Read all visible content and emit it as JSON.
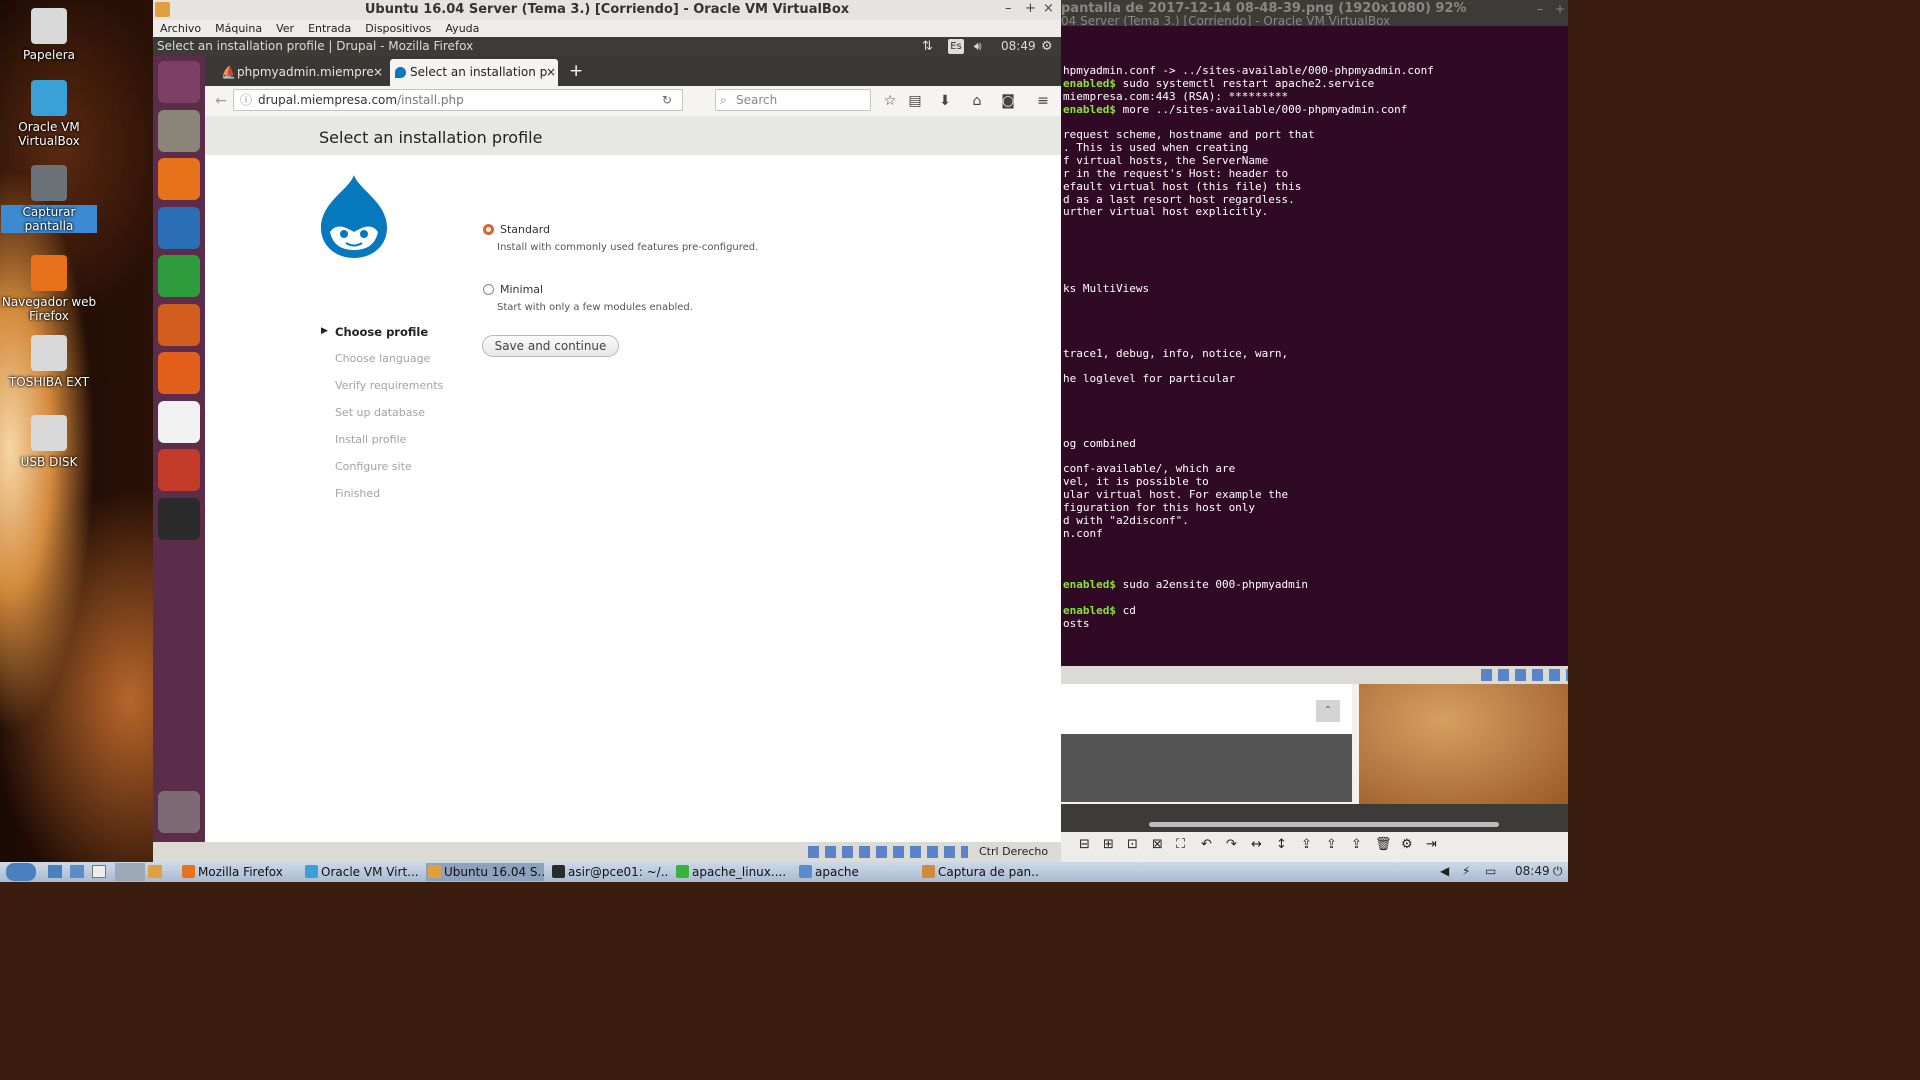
{
  "desktop": {
    "icons": [
      {
        "label": "Papelera",
        "icon": "trash-icon",
        "color": "#d9d9d9"
      },
      {
        "label": "Oracle VM VirtualBox",
        "icon": "virtualbox-icon",
        "color": "#3aa0d8"
      },
      {
        "label": "Capturar pantalla",
        "icon": "camera-icon",
        "color": "#6b7278"
      },
      {
        "label": "Navegador web Firefox",
        "icon": "firefox-icon",
        "color": "#e8711c"
      },
      {
        "label": "TOSHIBA EXT",
        "icon": "usb-drive-icon",
        "color": "#d9d9d9"
      },
      {
        "label": "USB DISK",
        "icon": "usb-drive-icon",
        "color": "#d9d9d9"
      }
    ]
  },
  "vbox": {
    "title": "Ubuntu 16.04 Server (Tema 3.) [Corriendo] - Oracle VM VirtualBox",
    "menu": [
      "Archivo",
      "Máquina",
      "Ver",
      "Entrada",
      "Dispositivos",
      "Ayuda"
    ],
    "status_host_key": "Ctrl Derecho"
  },
  "guest": {
    "window_title": "Select an installation profile | Drupal - Mozilla Firefox",
    "keyboard": "Es",
    "clock": "08:49",
    "launcher": [
      {
        "icon": "ubuntu-dash-icon",
        "color": "#7d3f66"
      },
      {
        "icon": "files-icon",
        "color": "#8c8579"
      },
      {
        "icon": "firefox-icon",
        "color": "#e8711c"
      },
      {
        "icon": "writer-icon",
        "color": "#2a6fb6"
      },
      {
        "icon": "calc-icon",
        "color": "#2e9c3d"
      },
      {
        "icon": "impress-icon",
        "color": "#d35d1e"
      },
      {
        "icon": "software-center-icon",
        "color": "#e45f1c"
      },
      {
        "icon": "amazon-icon",
        "color": "#f1f1f1"
      },
      {
        "icon": "system-settings-icon",
        "color": "#c43b2a"
      },
      {
        "icon": "terminal-icon",
        "color": "#2b2b2b"
      },
      {
        "icon": "trash-icon",
        "color": "#7d6a74"
      }
    ]
  },
  "firefox": {
    "tabs": [
      {
        "label": "phpmyadmin.miempre",
        "active": false
      },
      {
        "label": "Select an installation p",
        "active": true
      }
    ],
    "url_host": "drupal.miempresa.com",
    "url_path": "/install.php",
    "search_placeholder": "Search"
  },
  "drupal": {
    "page_title": "Select an installation profile",
    "steps": [
      "Choose profile",
      "Choose language",
      "Verify requirements",
      "Set up database",
      "Install profile",
      "Configure site",
      "Finished"
    ],
    "active_step": 0,
    "options": [
      {
        "label": "Standard",
        "description": "Install with commonly used features pre-configured.",
        "selected": true
      },
      {
        "label": "Minimal",
        "description": "Start with only a few modules enabled.",
        "selected": false
      }
    ],
    "submit_label": "Save and continue",
    "accent": "#0678be"
  },
  "viewer": {
    "title": "pantalla de 2017-12-14 08-48-39.png (1920x1080) 92%",
    "subtitle": "04 Server (Tema 3.) [Corriendo] - Oracle VM VirtualBox",
    "terminal_lines": [
      {
        "prompt": "",
        "text": "hpmyadmin.conf -> ../sites-available/000-phpmyadmin.conf"
      },
      {
        "prompt": "enabled$",
        "text": " sudo systemctl restart apache2.service"
      },
      {
        "prompt": "",
        "text": "miempresa.com:443 (RSA): *********"
      },
      {
        "prompt": "enabled$",
        "text": " more ../sites-available/000-phpmyadmin.conf"
      },
      {
        "prompt": "",
        "text": ""
      },
      {
        "prompt": "",
        "text": "request scheme, hostname and port that"
      },
      {
        "prompt": "",
        "text": ". This is used when creating"
      },
      {
        "prompt": "",
        "text": "f virtual hosts, the ServerName"
      },
      {
        "prompt": "",
        "text": "r in the request's Host: header to"
      },
      {
        "prompt": "",
        "text": "efault virtual host (this file) this"
      },
      {
        "prompt": "",
        "text": "d as a last resort host regardless."
      },
      {
        "prompt": "",
        "text": "urther virtual host explicitly."
      },
      {
        "prompt": "",
        "text": ""
      },
      {
        "prompt": "",
        "text": ""
      },
      {
        "prompt": "",
        "text": ""
      },
      {
        "prompt": "",
        "text": ""
      },
      {
        "prompt": "",
        "text": ""
      },
      {
        "prompt": "",
        "text": "ks MultiViews"
      },
      {
        "prompt": "",
        "text": ""
      },
      {
        "prompt": "",
        "text": ""
      },
      {
        "prompt": "",
        "text": ""
      },
      {
        "prompt": "",
        "text": ""
      },
      {
        "prompt": "",
        "text": "trace1, debug, info, notice, warn,"
      },
      {
        "prompt": "",
        "text": ""
      },
      {
        "prompt": "",
        "text": "he loglevel for particular"
      },
      {
        "prompt": "",
        "text": ""
      },
      {
        "prompt": "",
        "text": ""
      },
      {
        "prompt": "",
        "text": ""
      },
      {
        "prompt": "",
        "text": ""
      },
      {
        "prompt": "",
        "text": "og combined"
      },
      {
        "prompt": "",
        "text": ""
      },
      {
        "prompt": "",
        "text": "conf-available/, which are"
      },
      {
        "prompt": "",
        "text": "vel, it is possible to"
      },
      {
        "prompt": "",
        "text": "ular virtual host. For example the"
      },
      {
        "prompt": "",
        "text": "figuration for this host only"
      },
      {
        "prompt": "",
        "text": "d with \"a2disconf\"."
      },
      {
        "prompt": "",
        "text": "n.conf"
      },
      {
        "prompt": "",
        "text": ""
      },
      {
        "prompt": "",
        "text": ""
      },
      {
        "prompt": "",
        "text": ""
      },
      {
        "prompt": "enabled$",
        "text": " sudo a2ensite 000-phpmyadmin"
      },
      {
        "prompt": "",
        "text": ""
      },
      {
        "prompt": "enabled$",
        "text": " cd"
      },
      {
        "prompt": "",
        "text": "osts"
      }
    ]
  },
  "taskbar": {
    "items": [
      {
        "label": "Mozilla Firefox",
        "icon": "firefox-icon",
        "color": "#e8711c"
      },
      {
        "label": "Oracle VM Virt...",
        "icon": "virtualbox-icon",
        "color": "#3aa0d8"
      },
      {
        "label": "Ubuntu 16.04 S...",
        "icon": "vm-window-icon",
        "color": "#e0a040"
      },
      {
        "label": "asir@pce01: ~/...",
        "icon": "terminal-icon",
        "color": "#2b2b2b"
      },
      {
        "label": "apache_linux....",
        "icon": "document-icon",
        "color": "#3cb043"
      },
      {
        "label": "apache",
        "icon": "folder-icon",
        "color": "#5a8ccc"
      },
      {
        "label": "Captura de pan...",
        "icon": "image-viewer-icon",
        "color": "#d08a3a"
      }
    ],
    "clock": "08:49"
  }
}
